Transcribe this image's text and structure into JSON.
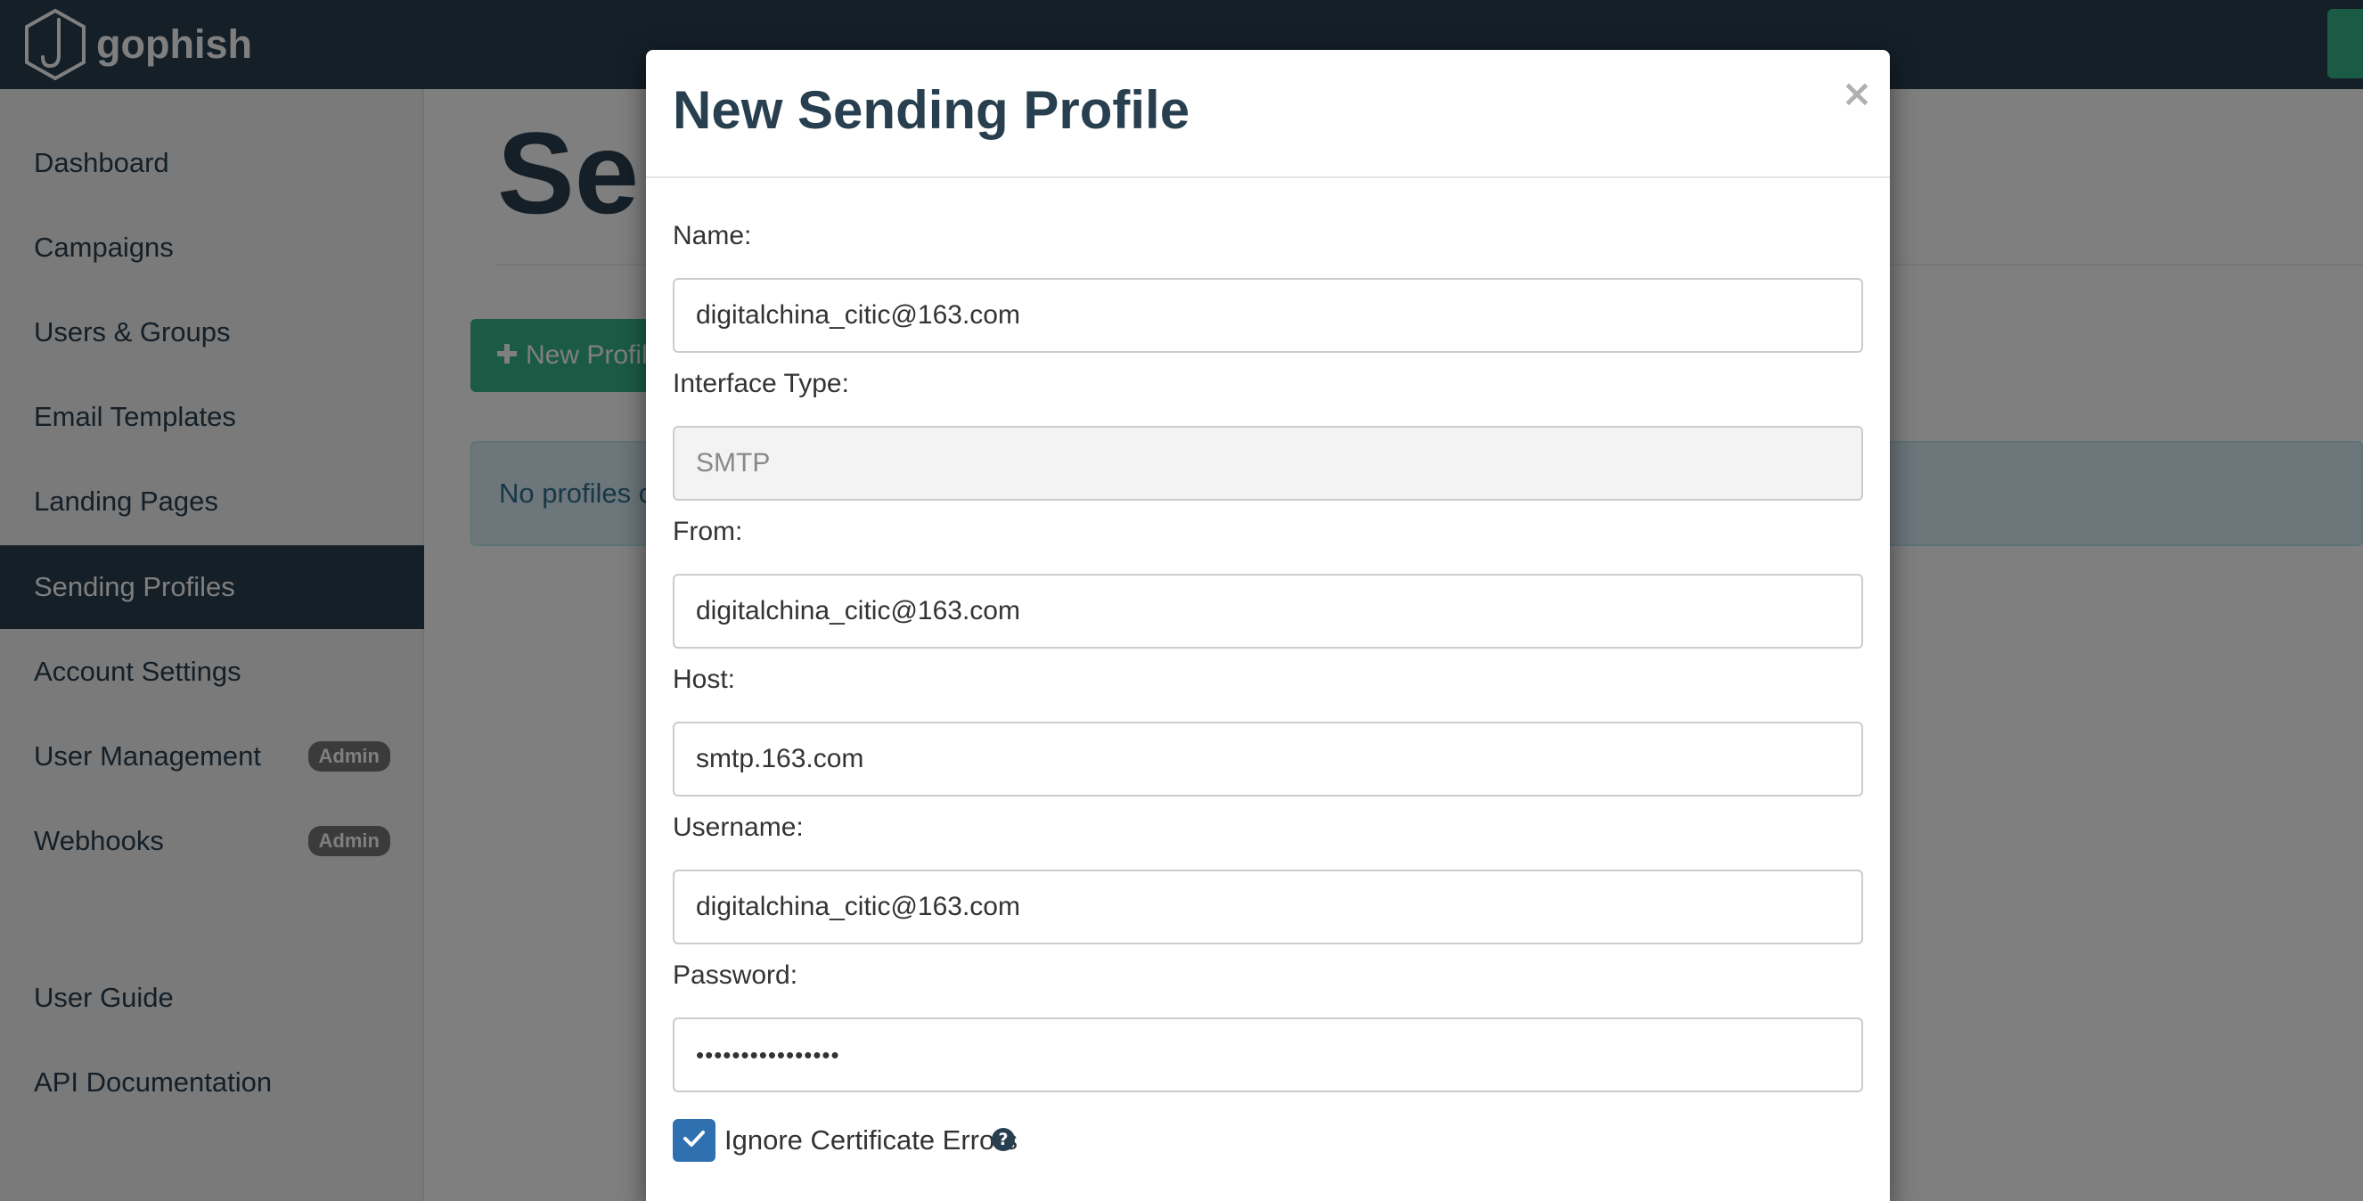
{
  "app": {
    "brand": "gophish",
    "page_title": "Sending Profiles"
  },
  "sidebar": {
    "items": [
      {
        "label": "Dashboard"
      },
      {
        "label": "Campaigns"
      },
      {
        "label": "Users & Groups"
      },
      {
        "label": "Email Templates"
      },
      {
        "label": "Landing Pages"
      },
      {
        "label": "Sending Profiles",
        "active": true
      },
      {
        "label": "Account Settings"
      },
      {
        "label": "User Management",
        "badge": "Admin"
      },
      {
        "label": "Webhooks",
        "badge": "Admin"
      },
      {
        "label": "User Guide"
      },
      {
        "label": "API Documentation"
      }
    ]
  },
  "main": {
    "new_profile_label": "New Profile",
    "empty_message": "No profiles created yet. Let's create one!"
  },
  "modal": {
    "title": "New Sending Profile",
    "close_glyph": "×",
    "fields": {
      "name": {
        "label": "Name:",
        "value": "digitalchina_citic@163.com"
      },
      "interface_type": {
        "label": "Interface Type:",
        "value": "SMTP"
      },
      "from": {
        "label": "From:",
        "value": "digitalchina_citic@163.com"
      },
      "host": {
        "label": "Host:",
        "value": "smtp.163.com"
      },
      "username": {
        "label": "Username:",
        "value": "digitalchina_citic@163.com"
      },
      "password": {
        "label": "Password:",
        "value": "••••••••••••••••"
      }
    },
    "ignore_cert": {
      "label": "Ignore Certificate Errors",
      "checked": true
    }
  },
  "colors": {
    "navbar": "#283f50",
    "accent_green": "#37b78c",
    "checkbox_blue": "#2f70b1",
    "badge_gray": "#777777"
  }
}
